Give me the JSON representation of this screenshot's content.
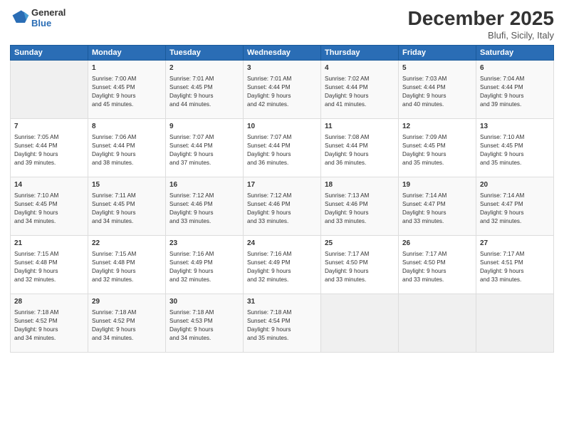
{
  "header": {
    "logo_general": "General",
    "logo_blue": "Blue",
    "month": "December 2025",
    "location": "Blufi, Sicily, Italy"
  },
  "days_of_week": [
    "Sunday",
    "Monday",
    "Tuesday",
    "Wednesday",
    "Thursday",
    "Friday",
    "Saturday"
  ],
  "weeks": [
    [
      {
        "num": "",
        "info": ""
      },
      {
        "num": "1",
        "info": "Sunrise: 7:00 AM\nSunset: 4:45 PM\nDaylight: 9 hours\nand 45 minutes."
      },
      {
        "num": "2",
        "info": "Sunrise: 7:01 AM\nSunset: 4:45 PM\nDaylight: 9 hours\nand 44 minutes."
      },
      {
        "num": "3",
        "info": "Sunrise: 7:01 AM\nSunset: 4:44 PM\nDaylight: 9 hours\nand 42 minutes."
      },
      {
        "num": "4",
        "info": "Sunrise: 7:02 AM\nSunset: 4:44 PM\nDaylight: 9 hours\nand 41 minutes."
      },
      {
        "num": "5",
        "info": "Sunrise: 7:03 AM\nSunset: 4:44 PM\nDaylight: 9 hours\nand 40 minutes."
      },
      {
        "num": "6",
        "info": "Sunrise: 7:04 AM\nSunset: 4:44 PM\nDaylight: 9 hours\nand 39 minutes."
      }
    ],
    [
      {
        "num": "7",
        "info": "Sunrise: 7:05 AM\nSunset: 4:44 PM\nDaylight: 9 hours\nand 39 minutes."
      },
      {
        "num": "8",
        "info": "Sunrise: 7:06 AM\nSunset: 4:44 PM\nDaylight: 9 hours\nand 38 minutes."
      },
      {
        "num": "9",
        "info": "Sunrise: 7:07 AM\nSunset: 4:44 PM\nDaylight: 9 hours\nand 37 minutes."
      },
      {
        "num": "10",
        "info": "Sunrise: 7:07 AM\nSunset: 4:44 PM\nDaylight: 9 hours\nand 36 minutes."
      },
      {
        "num": "11",
        "info": "Sunrise: 7:08 AM\nSunset: 4:44 PM\nDaylight: 9 hours\nand 36 minutes."
      },
      {
        "num": "12",
        "info": "Sunrise: 7:09 AM\nSunset: 4:45 PM\nDaylight: 9 hours\nand 35 minutes."
      },
      {
        "num": "13",
        "info": "Sunrise: 7:10 AM\nSunset: 4:45 PM\nDaylight: 9 hours\nand 35 minutes."
      }
    ],
    [
      {
        "num": "14",
        "info": "Sunrise: 7:10 AM\nSunset: 4:45 PM\nDaylight: 9 hours\nand 34 minutes."
      },
      {
        "num": "15",
        "info": "Sunrise: 7:11 AM\nSunset: 4:45 PM\nDaylight: 9 hours\nand 34 minutes."
      },
      {
        "num": "16",
        "info": "Sunrise: 7:12 AM\nSunset: 4:46 PM\nDaylight: 9 hours\nand 33 minutes."
      },
      {
        "num": "17",
        "info": "Sunrise: 7:12 AM\nSunset: 4:46 PM\nDaylight: 9 hours\nand 33 minutes."
      },
      {
        "num": "18",
        "info": "Sunrise: 7:13 AM\nSunset: 4:46 PM\nDaylight: 9 hours\nand 33 minutes."
      },
      {
        "num": "19",
        "info": "Sunrise: 7:14 AM\nSunset: 4:47 PM\nDaylight: 9 hours\nand 33 minutes."
      },
      {
        "num": "20",
        "info": "Sunrise: 7:14 AM\nSunset: 4:47 PM\nDaylight: 9 hours\nand 32 minutes."
      }
    ],
    [
      {
        "num": "21",
        "info": "Sunrise: 7:15 AM\nSunset: 4:48 PM\nDaylight: 9 hours\nand 32 minutes."
      },
      {
        "num": "22",
        "info": "Sunrise: 7:15 AM\nSunset: 4:48 PM\nDaylight: 9 hours\nand 32 minutes."
      },
      {
        "num": "23",
        "info": "Sunrise: 7:16 AM\nSunset: 4:49 PM\nDaylight: 9 hours\nand 32 minutes."
      },
      {
        "num": "24",
        "info": "Sunrise: 7:16 AM\nSunset: 4:49 PM\nDaylight: 9 hours\nand 32 minutes."
      },
      {
        "num": "25",
        "info": "Sunrise: 7:17 AM\nSunset: 4:50 PM\nDaylight: 9 hours\nand 33 minutes."
      },
      {
        "num": "26",
        "info": "Sunrise: 7:17 AM\nSunset: 4:50 PM\nDaylight: 9 hours\nand 33 minutes."
      },
      {
        "num": "27",
        "info": "Sunrise: 7:17 AM\nSunset: 4:51 PM\nDaylight: 9 hours\nand 33 minutes."
      }
    ],
    [
      {
        "num": "28",
        "info": "Sunrise: 7:18 AM\nSunset: 4:52 PM\nDaylight: 9 hours\nand 34 minutes."
      },
      {
        "num": "29",
        "info": "Sunrise: 7:18 AM\nSunset: 4:52 PM\nDaylight: 9 hours\nand 34 minutes."
      },
      {
        "num": "30",
        "info": "Sunrise: 7:18 AM\nSunset: 4:53 PM\nDaylight: 9 hours\nand 34 minutes."
      },
      {
        "num": "31",
        "info": "Sunrise: 7:18 AM\nSunset: 4:54 PM\nDaylight: 9 hours\nand 35 minutes."
      },
      {
        "num": "",
        "info": ""
      },
      {
        "num": "",
        "info": ""
      },
      {
        "num": "",
        "info": ""
      }
    ]
  ]
}
